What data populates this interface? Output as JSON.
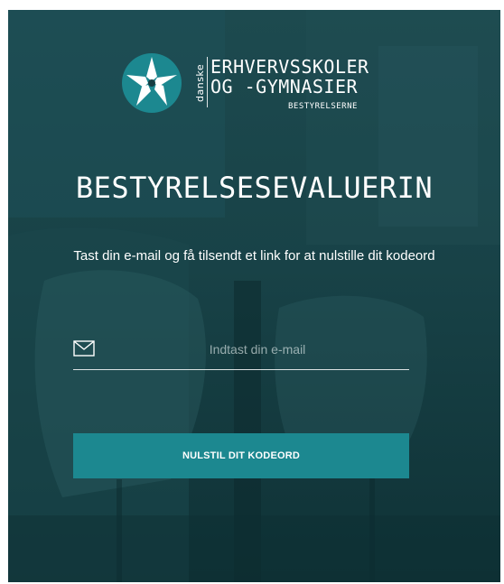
{
  "logo": {
    "vertical_text": "danske",
    "line1": "ERHVERVSSKOLER",
    "line2": "OG -GYMNASIER",
    "line3": "BESTYRELSERNE"
  },
  "page": {
    "title": "BESTYRELSESEVALUERIN",
    "subtitle": "Tast din e-mail og få tilsendt et link for at nulstille dit kodeord"
  },
  "form": {
    "email_icon": "envelope-icon",
    "email_value": "",
    "email_placeholder": "Indtast din e-mail",
    "submit_label": "NULSTIL DIT KODEORD"
  },
  "colors": {
    "background": "#163d42",
    "accent": "#1c8890",
    "text": "#ffffff"
  }
}
